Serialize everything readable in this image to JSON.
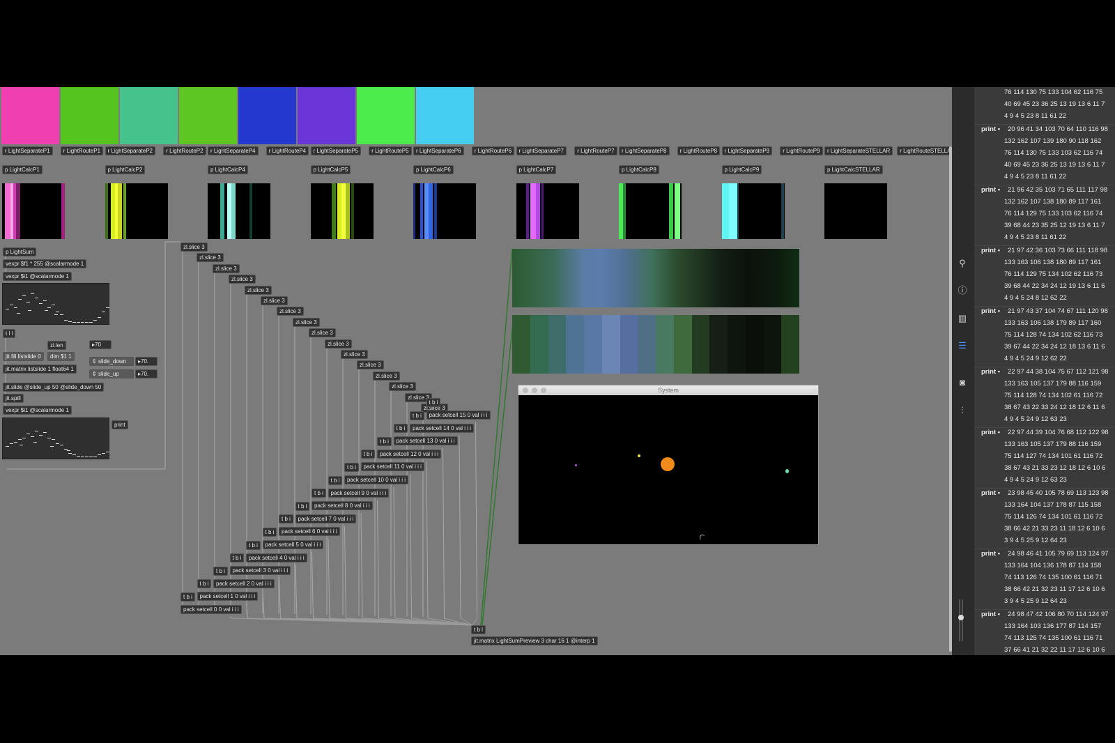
{
  "swatches": [
    {
      "name": "swatch-pink",
      "color": "#f03fb0"
    },
    {
      "name": "swatch-green",
      "color": "#56c41f"
    },
    {
      "name": "swatch-teal",
      "color": "#46c38c"
    },
    {
      "name": "swatch-lime",
      "color": "#5ec622"
    },
    {
      "name": "swatch-blue",
      "color": "#2238cf"
    },
    {
      "name": "swatch-purple",
      "color": "#6a35d7"
    },
    {
      "name": "swatch-brightgreen",
      "color": "#4cec4c"
    },
    {
      "name": "swatch-cyan",
      "color": "#44cdee"
    }
  ],
  "light_channels": [
    {
      "separate": "r LightSeparateP1",
      "route": "r LightRouteP1",
      "calc": "p LightCalcP1"
    },
    {
      "separate": "r LightSeparateP2",
      "route": "r LightRouteP2",
      "calc": "p LightCalcP2"
    },
    {
      "separate": "r LightSeparateP4",
      "route": "r LightRouteP4",
      "calc": "p LightCalcP4"
    },
    {
      "separate": "r LightSeparateP5",
      "route": "r LightRouteP5",
      "calc": "p LightCalcP5"
    },
    {
      "separate": "r LightSeparateP6",
      "route": "r LightRouteP6",
      "calc": "p LightCalcP6"
    },
    {
      "separate": "r LightSeparateP7",
      "route": "r LightRouteP7",
      "calc": "p LightCalcP7"
    },
    {
      "separate": "r LightSeparateP8",
      "route": "r LightRouteP8",
      "calc": "p LightCalcP8"
    },
    {
      "separate": "r LightSeparateP9",
      "route": "r LightRouteP9",
      "calc": "p LightCalcP9"
    },
    {
      "separate": "r LightSeparateSTELLAR",
      "route": "r LightRouteSTELLAR",
      "calc": "p LightCalcSTELLAR"
    }
  ],
  "left_chain": {
    "lightsum": "p LightSum",
    "vexpr1": "vexpr $f1 * 255 @scalarmode 1",
    "vexpr2": "vexpr $i1 @scalarmode 1",
    "tll": "t l l",
    "zllen": "zl.len",
    "num70": "70",
    "jitfill": "jit.fill listslide 0",
    "dim": "dim $1 1",
    "jitmatrix": "jit.matrix listslide 1 float64 1",
    "slide_down": "slide_down",
    "slide_down_val": "70.",
    "slide_up": "slide_up",
    "slide_up_val": "70.",
    "jitslide": "jit.slide @slide_up 50 @slide_down 50",
    "jitspill": "jit.spill",
    "vexpr3": "vexpr $i1 @scalarmode 1",
    "print": "print"
  },
  "slice_label": "zl.slice 3",
  "tbi_label": "t b i",
  "tbl_label": "t b l",
  "pack_cells": [
    "pack setcell 0 0 val i i i",
    "pack setcell 1 0 val i i i",
    "pack setcell 2 0 val i i i",
    "pack setcell 3 0 val i i i",
    "pack setcell 4 0 val i i i",
    "pack setcell 5 0 val i i i",
    "pack setcell 6 0 val i i i",
    "pack setcell 7 0 val i i i",
    "pack setcell 8 0 val i i i",
    "pack setcell 9 0 val i i i",
    "pack setcell 10 0 val i i i",
    "pack setcell 11 0 val i i i",
    "pack setcell 12 0 val i i i",
    "pack setcell 13 0 val i i i",
    "pack setcell 14 0 val i i i",
    "pack setcell 15 0 val i i i"
  ],
  "jit_matrix_out": "jit.matrix LightSumPreview 3 char 16 1 @interp 1",
  "preview_strip_colors": [
    "#2f5a32",
    "#336b4f",
    "#3e6d6a",
    "#4f7393",
    "#5a78a6",
    "#6b86b4",
    "#566fa0",
    "#4e6f86",
    "#487a62",
    "#3f6a3e",
    "#233c21",
    "#151f16",
    "#0e150e",
    "#0a0f0a",
    "#0c140c",
    "#21401d"
  ],
  "system_window": {
    "title": "System"
  },
  "console": {
    "entries": [
      {
        "prefix": "",
        "lines": [
          "76 114 130 75 133 104 62 116 75",
          "40 69 45 23 36 25 13 19 13 6 11 7",
          "4 9 4 5 23 8 11 61 22"
        ]
      },
      {
        "prefix": "print •",
        "lines": [
          "20 96 41 34 103 70 64 110 116 98",
          "132 162 107 139 180 90 118 162",
          "76 114 130 75 133 103 62 116 74",
          "40 69 45 23 36 25 13 19 13 6 11 7",
          "4 9 4 5 23 8 11 61 22"
        ]
      },
      {
        "prefix": "print •",
        "lines": [
          "21 96 42 35 103 71 65 111 117 98",
          "132 162 107 138 180 89 117 161",
          "76 114 129 75 133 103 62 116 74",
          "39 68 44 23 35 25 12 19 13 6 11 7",
          "4 9 4 5 23 8 11 61 22"
        ]
      },
      {
        "prefix": "print •",
        "lines": [
          "21 97 42 36 103 73 66 111 118 98",
          "133 163 106 138 180 89 117 161",
          "76 114 129 75 134 102 62 116 73",
          "39 68 44 22 34 24 12 19 13 6 11 6",
          "4 9 4 5 24 8 12 62 22"
        ]
      },
      {
        "prefix": "print •",
        "lines": [
          "21 97 43 37 104 74 67 111 120 98",
          "133 163 106 138 179 89 117 160",
          "75 114 128 74 134 102 62 116 73",
          "39 67 44 22 34 24 12 18 13 6 11 6",
          "4 9 4 5 24 9 12 62 22"
        ]
      },
      {
        "prefix": "print •",
        "lines": [
          "22 97 44 38 104 75 67 112 121 98",
          "133 163 105 137 179 88 116 159",
          "75 114 128 74 134 102 61 116 72",
          "38 67 43 22 33 24 12 18 12 6 11 6",
          "4 9 4 5 24 9 12 63 23"
        ]
      },
      {
        "prefix": "print •",
        "lines": [
          "22 97 44 39 104 76 68 112 122 98",
          "133 163 105 137 179 88 116 159",
          "75 114 127 74 134 101 61 116 72",
          "38 67 43 21 33 23 12 18 12 6 10 6",
          "4 9 4 5 24 9 12 63 23"
        ]
      },
      {
        "prefix": "print •",
        "lines": [
          "23 98 45 40 105 78 69 113 123 98",
          "133 164 104 137 178 87 115 158",
          "75 114 126 74 134 101 61 116 72",
          "38 66 42 21 33 23 11 18 12 6 10 6",
          "3 9 4 5 25 9 12 64 23"
        ]
      },
      {
        "prefix": "print •",
        "lines": [
          "24 98 46 41 105 79 69 113 124 97",
          "133 164 104 136 178 87 114 158",
          "74 113 126 74 135 100 61 116 71",
          "38 66 42 21 32 23 11 17 12 6 10 6",
          "3 9 4 5 25 9 12 64 23"
        ]
      },
      {
        "prefix": "print •",
        "lines": [
          "24 98 47 42 106 80 70 114 124 97",
          "133 164 103 136 177 87 114 157",
          "74 113 125 74 135 100 61 116 71",
          "37 66 41 21 32 22 11 17 12 6 10 6"
        ]
      }
    ]
  },
  "toolbar_icons": [
    "search-icon",
    "info-icon",
    "book-icon",
    "list-icon",
    "camera-icon",
    "sliders-icon"
  ]
}
